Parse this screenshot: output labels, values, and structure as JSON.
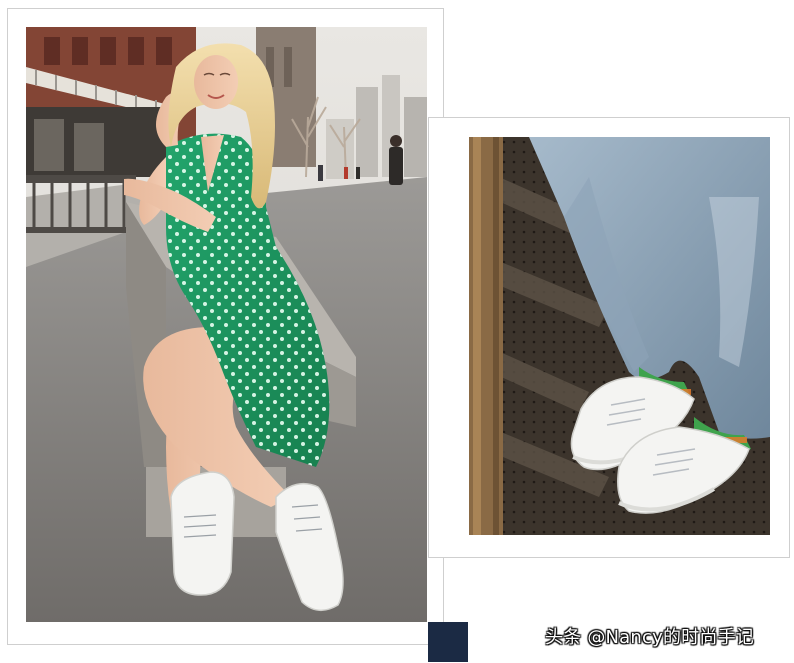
{
  "watermark": {
    "text": "头条 @Nancy的时尚手记"
  },
  "colors": {
    "frame_border": "#cfcfcf",
    "accent_square": "#1b2a44",
    "dress_green": "#1f9a63",
    "sneaker_white": "#f4f4f2",
    "jeans_blue": "#8aa2b8",
    "socks_green": "#3fa34d"
  },
  "images": {
    "left_photo": "woman-in-green-polka-dot-dress-sitting-on-bench",
    "right_photo": "close-up-white-sneakers-with-green-socks-and-jeans"
  }
}
